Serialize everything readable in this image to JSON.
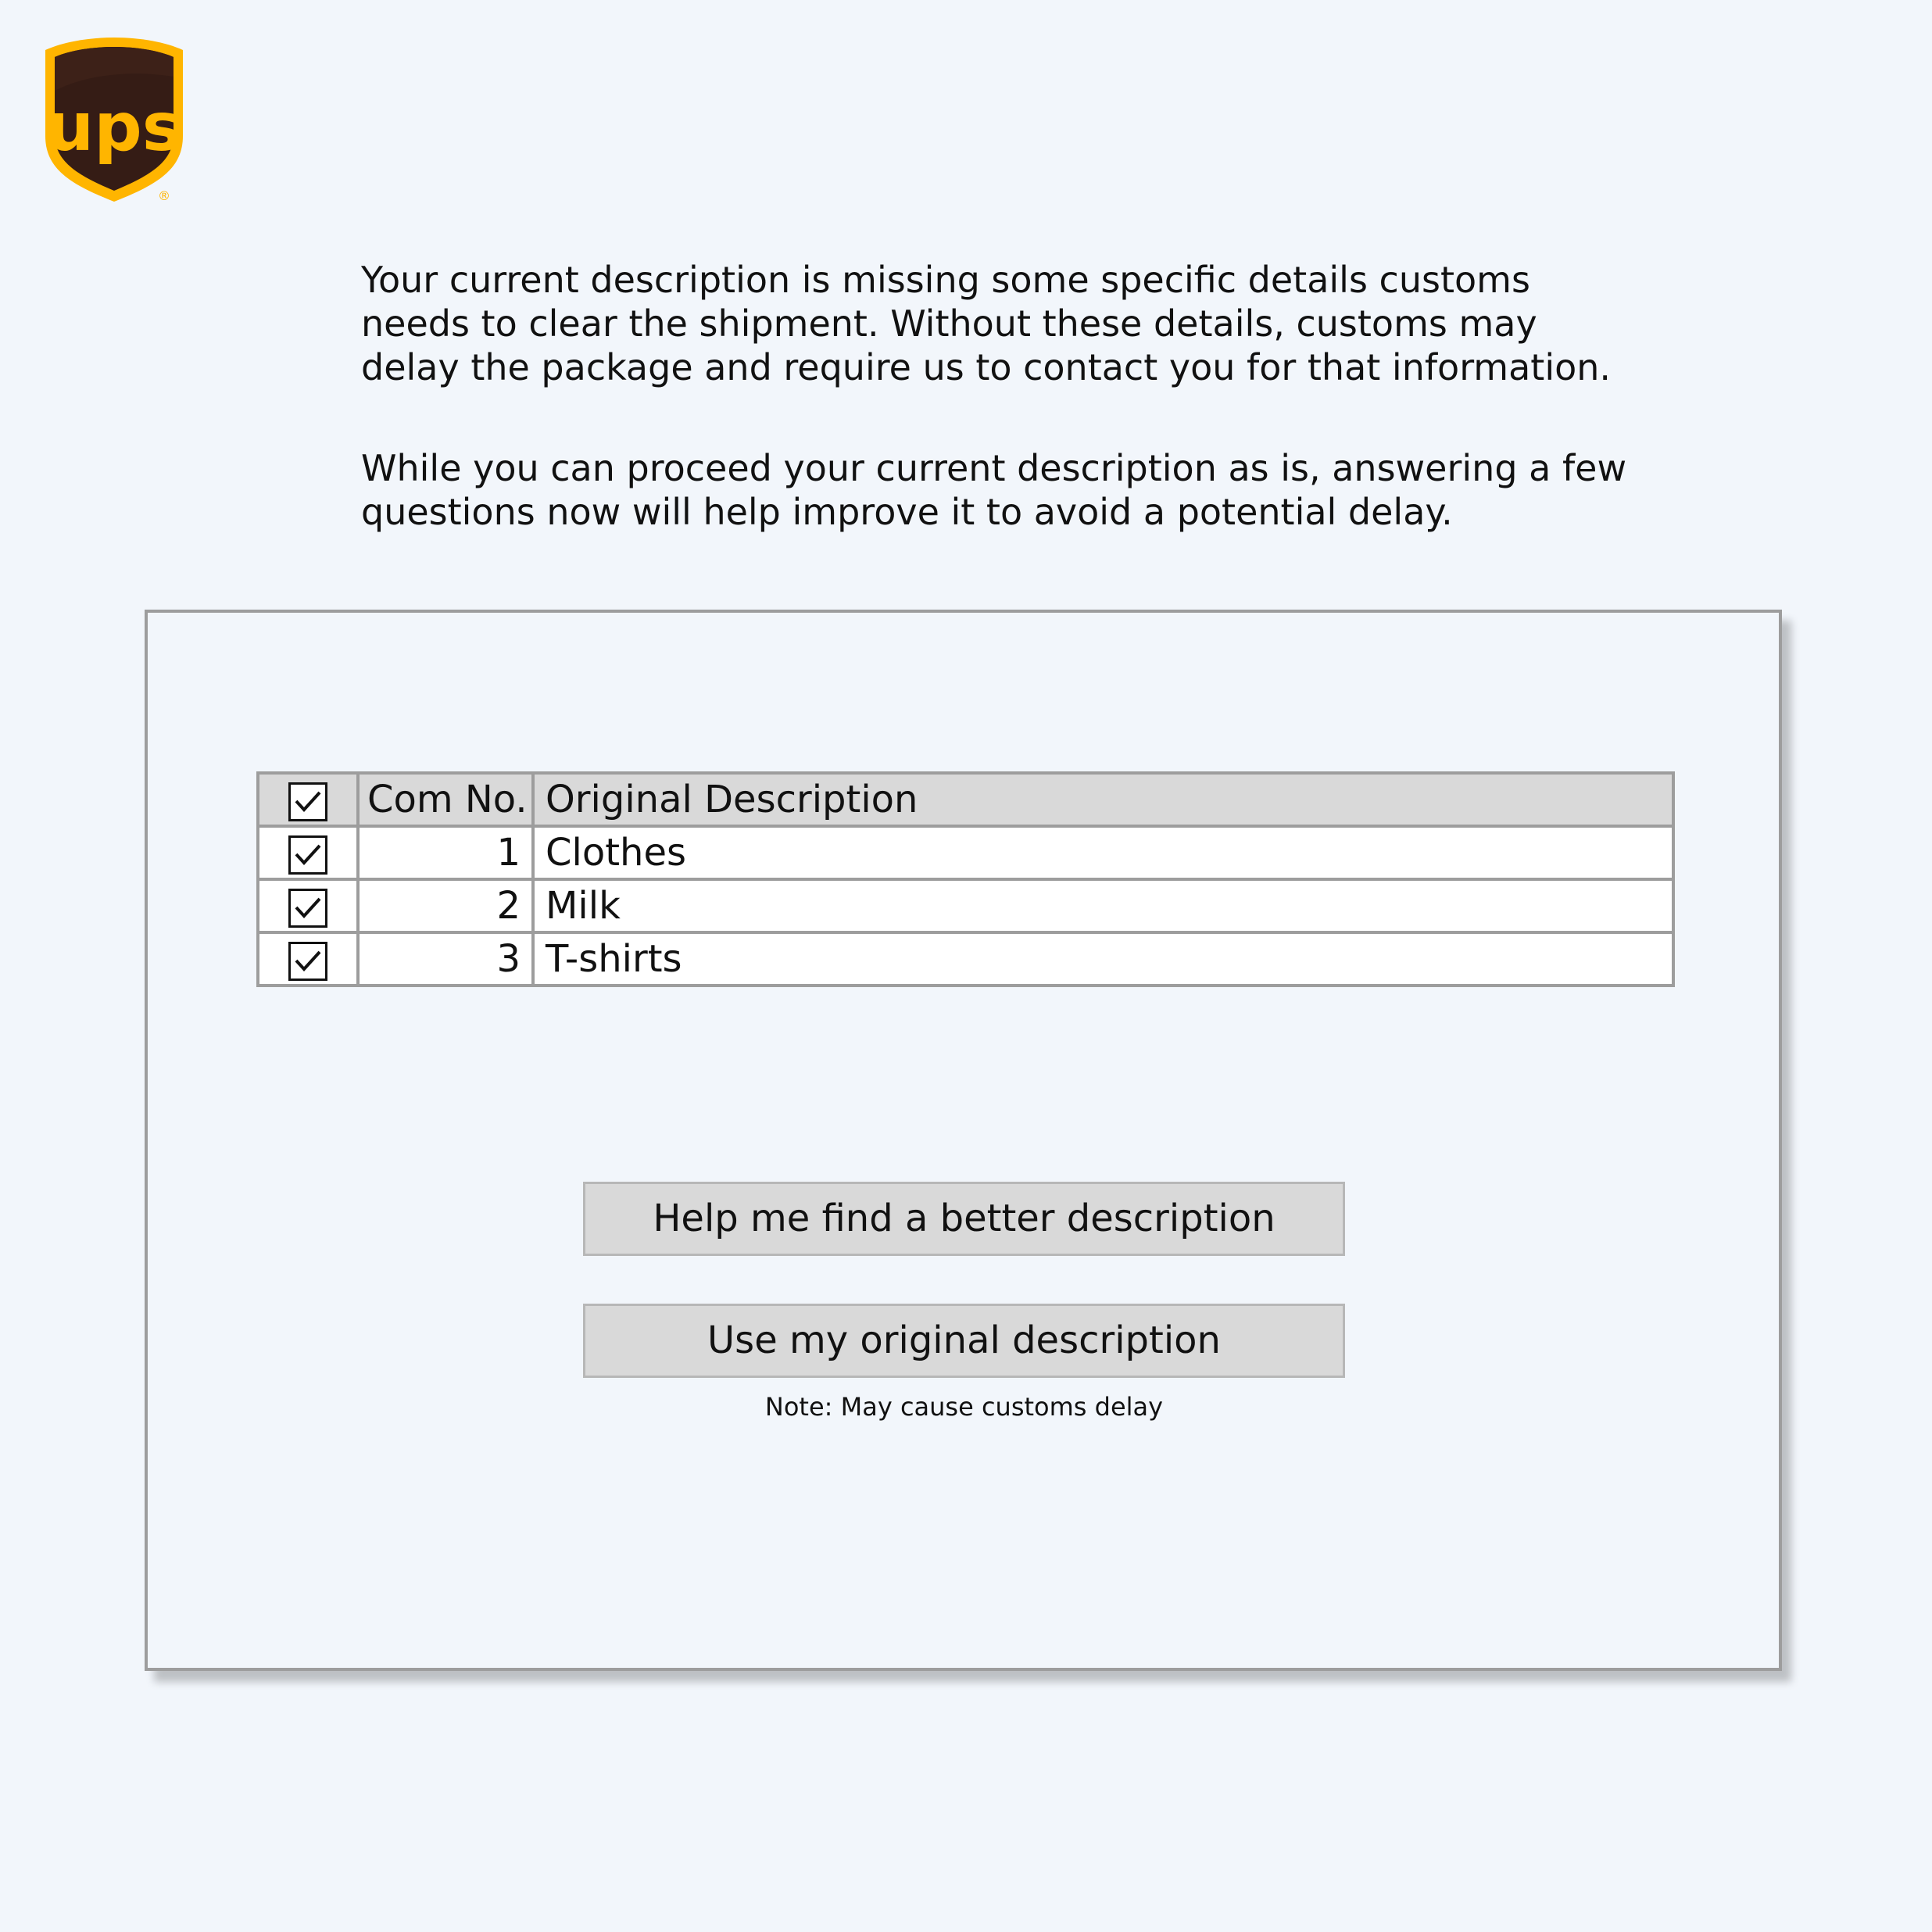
{
  "logo": {
    "brand": "ups",
    "registered_mark": "®",
    "colors": {
      "shield": "#351c15",
      "gold": "#ffb500"
    }
  },
  "intro": {
    "paragraph_1": "Your current description is missing some specific details customs needs to clear the shipment. Without these details, customs may delay the package and require us to contact you for that information.",
    "paragraph_2": "While you can proceed your current description as is, answering a few questions now will help improve it to avoid a potential delay."
  },
  "table": {
    "header": {
      "select_all_checked": true,
      "com_no": "Com No.",
      "original_description": "Original Description"
    },
    "rows": [
      {
        "checked": true,
        "com_no": "1",
        "description": "Clothes"
      },
      {
        "checked": true,
        "com_no": "2",
        "description": "Milk"
      },
      {
        "checked": true,
        "com_no": "3",
        "description": "T-shirts"
      }
    ]
  },
  "actions": {
    "help_label": "Help me find a better description",
    "original_label": "Use my original description",
    "note": "Note: May cause customs delay"
  }
}
